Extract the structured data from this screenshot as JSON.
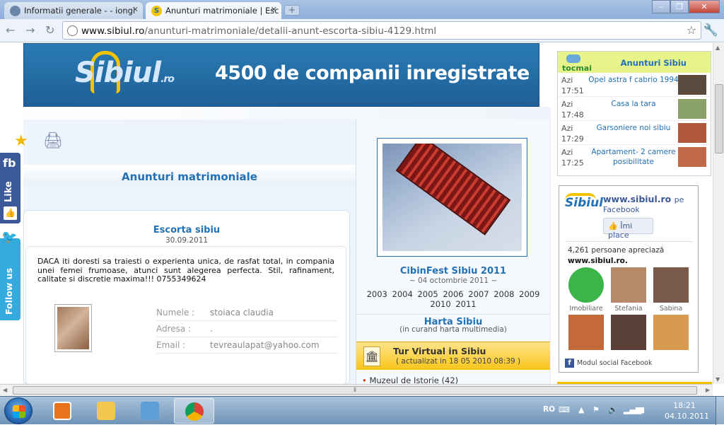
{
  "browser": {
    "tabs": [
      {
        "title": "Informatii generale - - iongi"
      },
      {
        "title": "Anunturi matrimoniale | Esc"
      }
    ],
    "url_host": "www.sibiul.ro",
    "url_path": "/anunturi-matrimoniale/detalii-anunt-escorta-sibiu-4129.html"
  },
  "banner": {
    "logo_main": "Sibiul",
    "logo_suffix": ".ro",
    "tagline": "4500 de companii inregistrate"
  },
  "left": {
    "section_title": "Anunturi matrimoniale",
    "post": {
      "title": "Escorta sibiu",
      "date": "30.09.2011",
      "text": "DACA iti doresti sa traiesti o experienta unica, de rasfat total, in compania unei femei frumoase, atunci sunt alegerea perfecta. Stil, rafinament, calitate si discretie maxima!!! 0755349624",
      "fields": [
        {
          "label": "Numele :",
          "value": "stoiaca claudia"
        },
        {
          "label": "Adresa :",
          "value": "."
        },
        {
          "label": "Email :",
          "value": "tevreaulapat@yahoo.com"
        }
      ]
    }
  },
  "middle": {
    "cibin_title": "CibinFest Sibiu 2011",
    "cibin_date": "~ 04 octombrie 2011 ~",
    "years": "2003  2004  2005  2006  2007  2008  2009  2010  2011",
    "harta_title": "Harta Sibiu",
    "harta_sub": "(in curand harta multimedia)",
    "tur_title": "Tur Virtual in Sibiu",
    "tur_sub": "( actualizat in 18 05 2010 08:39 )",
    "muzeu_name": "Muzeul de Istorie",
    "muzeu_count": "(42)"
  },
  "ads": {
    "brand": "tocmai",
    "title": "Anunturi Sibiu",
    "items": [
      {
        "day": "Azi",
        "time": "17:51",
        "text": "Opel astra f cabrio 1994",
        "thumb_color": "#5a4a3e"
      },
      {
        "day": "Azi",
        "time": "17:48",
        "text": "Casa la tara",
        "thumb_color": "#8aa26a"
      },
      {
        "day": "Azi",
        "time": "17:29",
        "text": "Garsoniere noi sibiu",
        "thumb_color": "#b0583c"
      },
      {
        "day": "Azi",
        "time": "17:25",
        "text": "Apartament- 2 camere posibilitate",
        "thumb_color": "#c06a4a"
      }
    ]
  },
  "facebook": {
    "name": "www.sibiul.ro",
    "name_suffix": "pe",
    "name_line2": "Facebook",
    "like_label": "Îmi place",
    "count_line": "4,261 persoane apreciază",
    "count_site": "www.sibiul.ro.",
    "people": [
      {
        "name": "Imobiliare",
        "color": "#3bb54a"
      },
      {
        "name": "Stefania",
        "color": "#b48a6a"
      },
      {
        "name": "Sabina",
        "color": "#7a5a4a"
      },
      {
        "name": "",
        "color": "#c46a3a"
      },
      {
        "name": "",
        "color": "#5a4036"
      },
      {
        "name": "",
        "color": "#d79a50"
      }
    ],
    "footer": "Modul social Facebook"
  },
  "side_widgets": {
    "fb_short": "fb",
    "fb_like": "Like",
    "twitter": "Follow us"
  },
  "taskbar": {
    "lang": "RO",
    "time": "18:21",
    "date": "04.10.2011"
  }
}
